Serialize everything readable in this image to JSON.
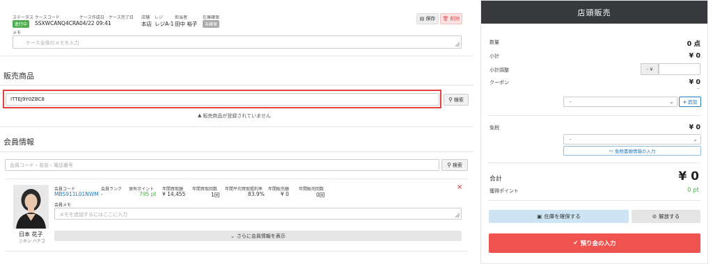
{
  "case": {
    "status_label": "ステータス",
    "status_badge": "進行中",
    "code_label": "ケースコード",
    "code_value": "SSXWCANQ4CRA",
    "created_label": "ケース作成日",
    "created_value": "04/22 09:41",
    "completed_label": "ケース完了日",
    "completed_value": "-",
    "store_label": "店舗",
    "store_value": "本店",
    "register_label": "レジ",
    "register_value": "レジA-1",
    "staff_label": "担当者",
    "staff_value": "田中 裕子",
    "stock_label": "在庫確保",
    "stock_badge": "未確保",
    "save_label": "保存",
    "delete_label": "削除",
    "memo_label": "メモ",
    "memo_placeholder": "ケース全体のメモを入力"
  },
  "products": {
    "title": "販売商品",
    "input_value": "ITTEJ9Y0ZBC8",
    "search_label": "検索",
    "empty_message": "販売商品が登録されていません"
  },
  "member": {
    "title": "会員情報",
    "search_placeholder": "会員コード・名前・電話番号",
    "search_label": "検索",
    "name": "日本 花子",
    "kana": "ニホン ハナコ",
    "code_label": "会員コード",
    "code_value": "MBS911L01NWM",
    "rank_label": "会員ランク",
    "rank_value": "-",
    "points_label": "保有ポイント",
    "points_value": "795 pt",
    "annual_buy_amount_label": "年間買取額",
    "annual_buy_amount_value": "¥ 14,455",
    "annual_buy_count_label": "年間買取回数",
    "annual_buy_count_value": "1回",
    "avg_rate_label": "年間平均買取粗利率",
    "avg_rate_value": "83.9%",
    "annual_sales_amount_label": "年間販売額",
    "annual_sales_amount_value": "¥ 0",
    "annual_sales_count_label": "年間販売回数",
    "annual_sales_count_value": "0回",
    "memo_label": "会員メモ",
    "memo_placeholder": "メモを追加するにはここに入力",
    "more_label": "さらに会員情報を表示",
    "remove_icon": "×"
  },
  "panel": {
    "title": "店頭販売",
    "qty_label": "数量",
    "qty_value": "0 点",
    "subtotal_label": "小計",
    "subtotal_value": "¥ 0",
    "adjust_label": "小計調整",
    "adjust_prefix": "- ¥",
    "coupon_label": "クーポン",
    "coupon_value": "¥ 0",
    "coupon_dash": "-",
    "coupon_select": "-",
    "add_label": "追加",
    "taxfree_label": "免税",
    "taxfree_value": "¥ 0",
    "taxfree_select": "-",
    "taxfree_doc_label": "免税書類情報の入力",
    "total_label": "合計",
    "total_value": "¥ 0",
    "points_label": "獲得ポイント",
    "points_value": "0 pt",
    "secure_label": "在庫を確保する",
    "release_label": "解放する",
    "deposit_label": "預り金の入力"
  },
  "colors": {
    "status_badge": "#4cae4c",
    "stock_badge": "#aaaaaa",
    "highlight_border": "#e8403a",
    "link": "#2a7ab8",
    "points_green": "#4cae4c",
    "secure_bg": "#cde4f5",
    "deposit_bg": "#ef5350",
    "header_dark": "#37393c"
  }
}
